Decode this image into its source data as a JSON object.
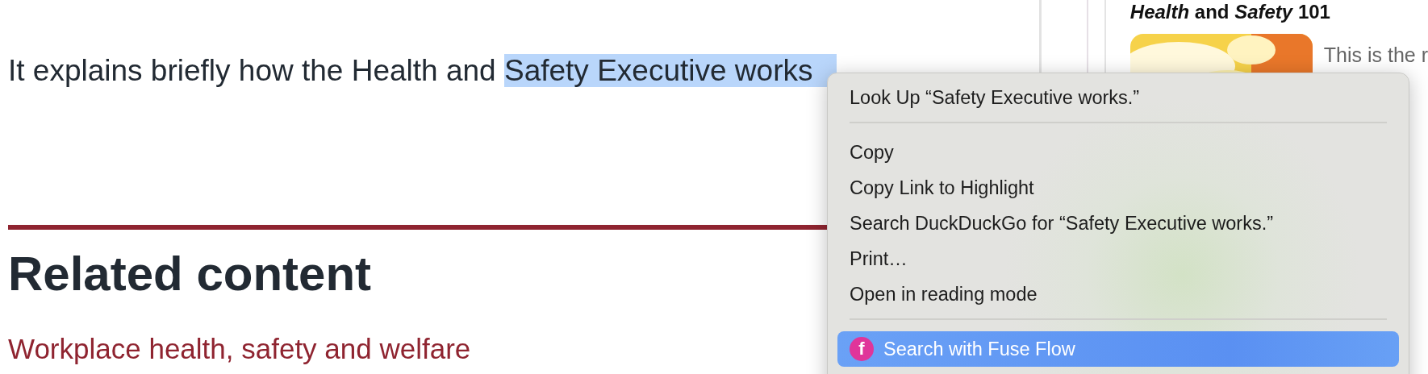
{
  "article": {
    "paragraph": "It explains briefly how the Health and ",
    "selection": "Safety Executive works",
    "heading": "Related content",
    "link": "Workplace health, safety and welfare"
  },
  "sidebar": {
    "title": "*Health* and *Safety* 101",
    "card": {
      "text": "This is the r"
    }
  },
  "context_menu": {
    "items": [
      {
        "kind": "item",
        "label": "Look Up “Safety Executive works.”",
        "selected": false
      },
      {
        "kind": "separator"
      },
      {
        "kind": "item",
        "label": "Copy",
        "selected": false
      },
      {
        "kind": "item",
        "label": "Copy Link to Highlight",
        "selected": false
      },
      {
        "kind": "item",
        "label": "Search DuckDuckGo for “Safety Executive works.”",
        "selected": false
      },
      {
        "kind": "item",
        "label": "Print…",
        "selected": false
      },
      {
        "kind": "item",
        "label": "Open in reading mode",
        "selected": false
      },
      {
        "kind": "separator"
      },
      {
        "kind": "extension",
        "label": "Search with Fuse Flow",
        "icon_letter": "f",
        "selected": true
      }
    ]
  }
}
